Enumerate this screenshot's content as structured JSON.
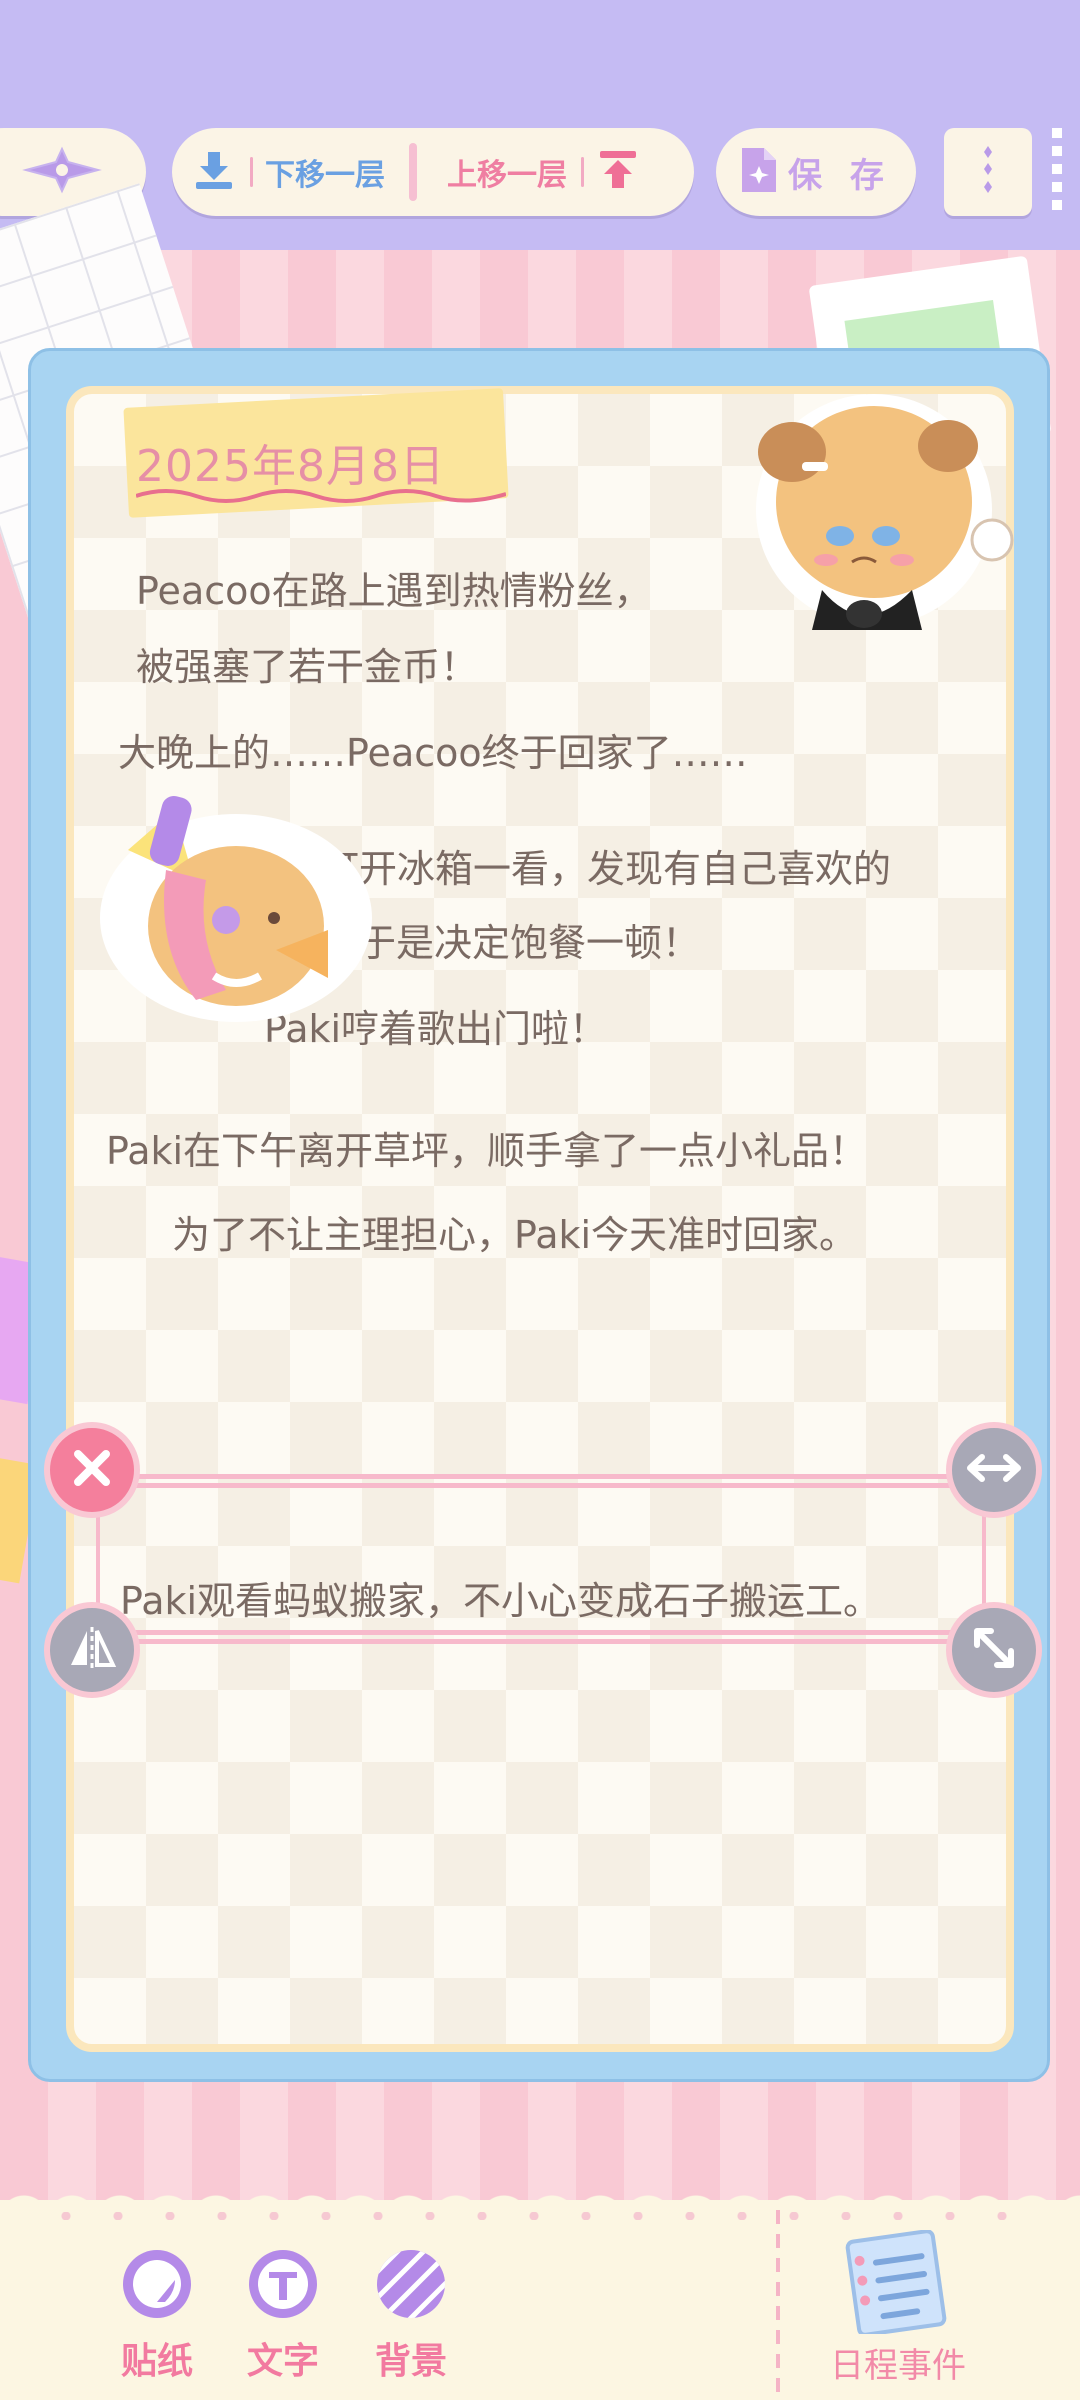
{
  "toolbar": {
    "back_icon": "compass-arrow-icon",
    "move_down_label": "下移一层",
    "move_up_label": "上移一层",
    "save_label": "保 存",
    "more_icon": "vertical-dots-icon"
  },
  "diary": {
    "date": "2025年8月8日",
    "entries": [
      "Peacoo在路上遇到热情粉丝，",
      "被强塞了若干金币！",
      "大晚上的……Peacoo终于回家了……",
      "Paki打开冰箱一看，发现有自己喜欢的",
      "沙拉，于是决定饱餐一顿！",
      "Paki哼着歌出门啦！",
      "Paki在下午离开草坪，顺手拿了一点小礼品！",
      "为了不让主理担心，Paki今天准时回家。"
    ],
    "selected_text": "Paki观看蚂蚁搬家，不小心变成石子搬运工。"
  },
  "bottom_tools": {
    "sticker_label": "贴纸",
    "text_label": "文字",
    "background_label": "背景",
    "schedule_label": "日程事件"
  },
  "colors": {
    "topbar": "#c5bbf3",
    "accent_pink": "#f27aa0",
    "accent_blue": "#6aa0e2",
    "card_border": "#a8d4f2"
  }
}
